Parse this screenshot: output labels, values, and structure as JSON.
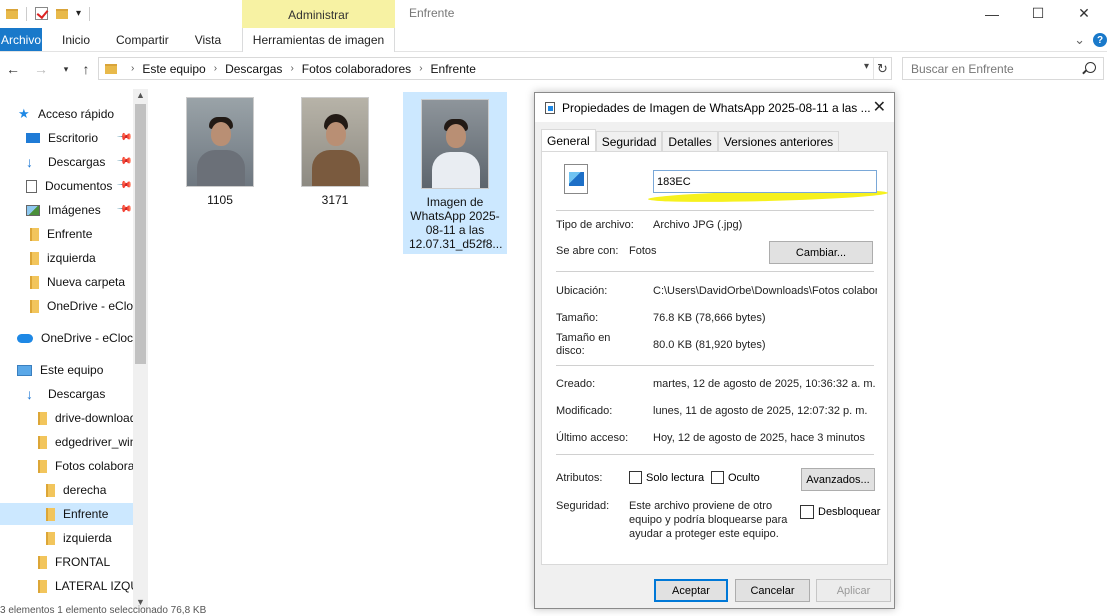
{
  "ribbon": {
    "contextual_header": "Administrar",
    "window_title": "Enfrente",
    "tabs": [
      "Archivo",
      "Inicio",
      "Compartir",
      "Vista",
      "Herramientas de imagen"
    ]
  },
  "address": {
    "crumbs": [
      "Este equipo",
      "Descargas",
      "Fotos colaboradores",
      "Enfrente"
    ],
    "search_placeholder": "Buscar en Enfrente"
  },
  "navpane": {
    "items": [
      {
        "label": "Acceso rápido",
        "icon": "star-icon"
      },
      {
        "label": "Escritorio",
        "icon": "desktop-icon"
      },
      {
        "label": "Descargas",
        "icon": "download-icon"
      },
      {
        "label": "Documentos",
        "icon": "documents-icon"
      },
      {
        "label": "Imágenes",
        "icon": "pictures-icon"
      },
      {
        "label": "Enfrente",
        "icon": "folder-icon"
      },
      {
        "label": "izquierda",
        "icon": "folder-icon"
      },
      {
        "label": "Nueva carpeta",
        "icon": "folder-icon"
      },
      {
        "label": "OneDrive - eClock",
        "icon": "folder-icon"
      },
      {
        "label": "OneDrive - eClock",
        "icon": "cloud-icon"
      },
      {
        "label": "Este equipo",
        "icon": "pc-icon"
      },
      {
        "label": "Descargas",
        "icon": "download-icon"
      },
      {
        "label": "drive-download",
        "icon": "folder-icon"
      },
      {
        "label": "edgedriver_win",
        "icon": "folder-icon"
      },
      {
        "label": "Fotos colaboradores",
        "icon": "folder-icon"
      },
      {
        "label": "derecha",
        "icon": "folder-icon"
      },
      {
        "label": "Enfrente",
        "icon": "folder-icon"
      },
      {
        "label": "izquierda",
        "icon": "folder-icon"
      },
      {
        "label": "FRONTAL",
        "icon": "folder-icon"
      },
      {
        "label": "LATERAL IZQUIERDO",
        "icon": "folder-icon"
      }
    ]
  },
  "files": [
    {
      "name": "1105"
    },
    {
      "name": "3171"
    },
    {
      "name": "Imagen de WhatsApp 2025-08-11 a las 12.07.31_d52f8..."
    }
  ],
  "statusbar": "3 elementos   1 elemento seleccionado  76,8 KB",
  "dialog": {
    "title": "Propiedades de Imagen de WhatsApp 2025-08-11 a las ...",
    "tabs": [
      "General",
      "Seguridad",
      "Detalles",
      "Versiones anteriores"
    ],
    "filename_value": "183EC",
    "type_label": "Tipo de archivo:",
    "type_value": "Archivo JPG (.jpg)",
    "opens_label": "Se abre con:",
    "opens_value": "Fotos",
    "change_button": "Cambiar...",
    "location_label": "Ubicación:",
    "location_value": "C:\\Users\\DavidOrbe\\Downloads\\Fotos colabora",
    "size_label": "Tamaño:",
    "size_value": "76.8 KB (78,666 bytes)",
    "disk_label_1": "Tamaño en",
    "disk_label_2": "disco:",
    "disk_value": "80.0 KB (81,920 bytes)",
    "created_label": "Creado:",
    "created_value": "martes, 12 de agosto de 2025, 10:36:32 a. m.",
    "modified_label": "Modificado:",
    "modified_value": "lunes, 11 de agosto de 2025, 12:07:32 p. m.",
    "accessed_label": "Último acceso:",
    "accessed_value": "Hoy, 12 de agosto de 2025, hace 3 minutos",
    "attributes_label": "Atributos:",
    "readonly_label": "Solo lectura",
    "hidden_label": "Oculto",
    "advanced_button": "Avanzados...",
    "security_label": "Seguridad:",
    "security_line1": "Este archivo proviene de otro",
    "security_line2": "equipo y podría bloquearse para",
    "security_line3": "ayudar a proteger este equipo.",
    "unblock_label": "Desbloquear",
    "ok_button": "Aceptar",
    "cancel_button": "Cancelar",
    "apply_button": "Aplicar"
  }
}
